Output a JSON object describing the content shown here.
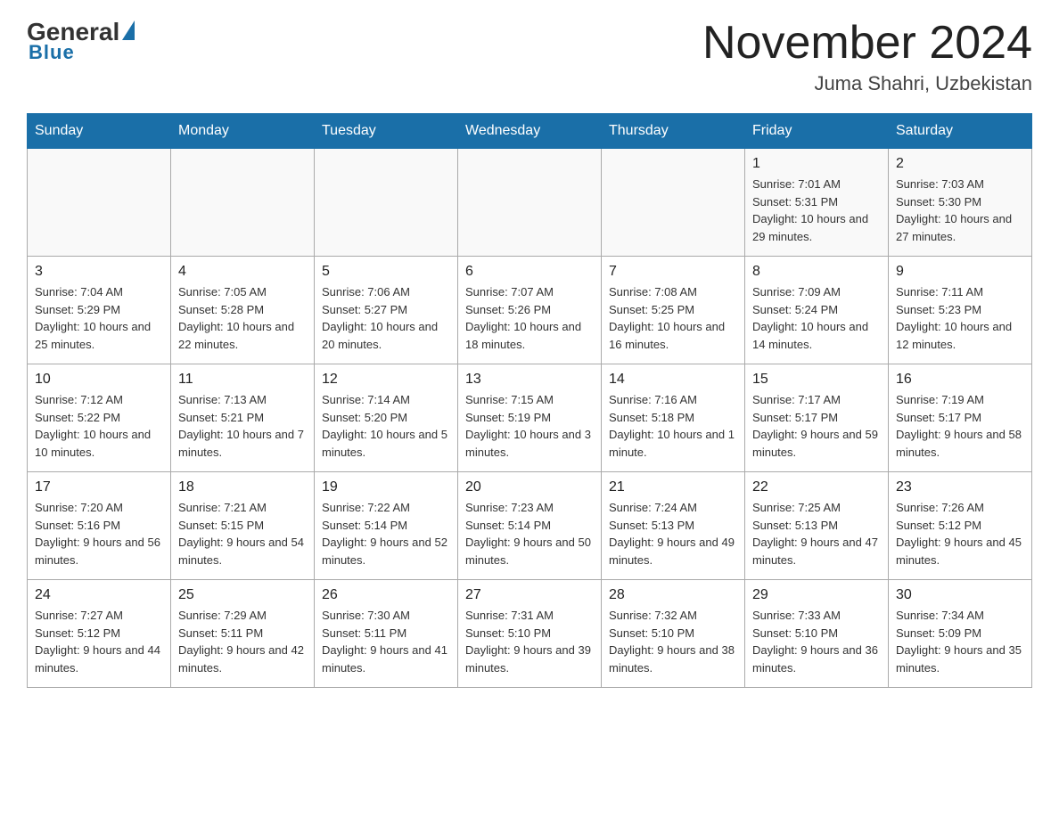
{
  "header": {
    "logo_general": "General",
    "logo_blue": "Blue",
    "month_title": "November 2024",
    "location": "Juma Shahri, Uzbekistan"
  },
  "days_of_week": [
    "Sunday",
    "Monday",
    "Tuesday",
    "Wednesday",
    "Thursday",
    "Friday",
    "Saturday"
  ],
  "weeks": [
    [
      {
        "day": "",
        "info": ""
      },
      {
        "day": "",
        "info": ""
      },
      {
        "day": "",
        "info": ""
      },
      {
        "day": "",
        "info": ""
      },
      {
        "day": "",
        "info": ""
      },
      {
        "day": "1",
        "info": "Sunrise: 7:01 AM\nSunset: 5:31 PM\nDaylight: 10 hours and 29 minutes."
      },
      {
        "day": "2",
        "info": "Sunrise: 7:03 AM\nSunset: 5:30 PM\nDaylight: 10 hours and 27 minutes."
      }
    ],
    [
      {
        "day": "3",
        "info": "Sunrise: 7:04 AM\nSunset: 5:29 PM\nDaylight: 10 hours and 25 minutes."
      },
      {
        "day": "4",
        "info": "Sunrise: 7:05 AM\nSunset: 5:28 PM\nDaylight: 10 hours and 22 minutes."
      },
      {
        "day": "5",
        "info": "Sunrise: 7:06 AM\nSunset: 5:27 PM\nDaylight: 10 hours and 20 minutes."
      },
      {
        "day": "6",
        "info": "Sunrise: 7:07 AM\nSunset: 5:26 PM\nDaylight: 10 hours and 18 minutes."
      },
      {
        "day": "7",
        "info": "Sunrise: 7:08 AM\nSunset: 5:25 PM\nDaylight: 10 hours and 16 minutes."
      },
      {
        "day": "8",
        "info": "Sunrise: 7:09 AM\nSunset: 5:24 PM\nDaylight: 10 hours and 14 minutes."
      },
      {
        "day": "9",
        "info": "Sunrise: 7:11 AM\nSunset: 5:23 PM\nDaylight: 10 hours and 12 minutes."
      }
    ],
    [
      {
        "day": "10",
        "info": "Sunrise: 7:12 AM\nSunset: 5:22 PM\nDaylight: 10 hours and 10 minutes."
      },
      {
        "day": "11",
        "info": "Sunrise: 7:13 AM\nSunset: 5:21 PM\nDaylight: 10 hours and 7 minutes."
      },
      {
        "day": "12",
        "info": "Sunrise: 7:14 AM\nSunset: 5:20 PM\nDaylight: 10 hours and 5 minutes."
      },
      {
        "day": "13",
        "info": "Sunrise: 7:15 AM\nSunset: 5:19 PM\nDaylight: 10 hours and 3 minutes."
      },
      {
        "day": "14",
        "info": "Sunrise: 7:16 AM\nSunset: 5:18 PM\nDaylight: 10 hours and 1 minute."
      },
      {
        "day": "15",
        "info": "Sunrise: 7:17 AM\nSunset: 5:17 PM\nDaylight: 9 hours and 59 minutes."
      },
      {
        "day": "16",
        "info": "Sunrise: 7:19 AM\nSunset: 5:17 PM\nDaylight: 9 hours and 58 minutes."
      }
    ],
    [
      {
        "day": "17",
        "info": "Sunrise: 7:20 AM\nSunset: 5:16 PM\nDaylight: 9 hours and 56 minutes."
      },
      {
        "day": "18",
        "info": "Sunrise: 7:21 AM\nSunset: 5:15 PM\nDaylight: 9 hours and 54 minutes."
      },
      {
        "day": "19",
        "info": "Sunrise: 7:22 AM\nSunset: 5:14 PM\nDaylight: 9 hours and 52 minutes."
      },
      {
        "day": "20",
        "info": "Sunrise: 7:23 AM\nSunset: 5:14 PM\nDaylight: 9 hours and 50 minutes."
      },
      {
        "day": "21",
        "info": "Sunrise: 7:24 AM\nSunset: 5:13 PM\nDaylight: 9 hours and 49 minutes."
      },
      {
        "day": "22",
        "info": "Sunrise: 7:25 AM\nSunset: 5:13 PM\nDaylight: 9 hours and 47 minutes."
      },
      {
        "day": "23",
        "info": "Sunrise: 7:26 AM\nSunset: 5:12 PM\nDaylight: 9 hours and 45 minutes."
      }
    ],
    [
      {
        "day": "24",
        "info": "Sunrise: 7:27 AM\nSunset: 5:12 PM\nDaylight: 9 hours and 44 minutes."
      },
      {
        "day": "25",
        "info": "Sunrise: 7:29 AM\nSunset: 5:11 PM\nDaylight: 9 hours and 42 minutes."
      },
      {
        "day": "26",
        "info": "Sunrise: 7:30 AM\nSunset: 5:11 PM\nDaylight: 9 hours and 41 minutes."
      },
      {
        "day": "27",
        "info": "Sunrise: 7:31 AM\nSunset: 5:10 PM\nDaylight: 9 hours and 39 minutes."
      },
      {
        "day": "28",
        "info": "Sunrise: 7:32 AM\nSunset: 5:10 PM\nDaylight: 9 hours and 38 minutes."
      },
      {
        "day": "29",
        "info": "Sunrise: 7:33 AM\nSunset: 5:10 PM\nDaylight: 9 hours and 36 minutes."
      },
      {
        "day": "30",
        "info": "Sunrise: 7:34 AM\nSunset: 5:09 PM\nDaylight: 9 hours and 35 minutes."
      }
    ]
  ]
}
